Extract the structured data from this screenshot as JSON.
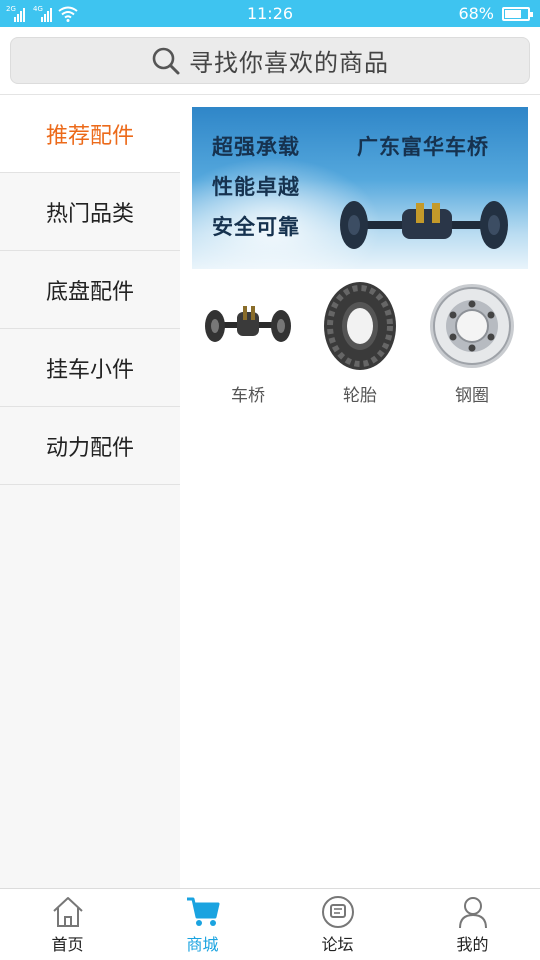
{
  "status_bar": {
    "sim1_network": "2G",
    "sim2_network": "4G",
    "time": "11:26",
    "battery_percent": "68%",
    "battery_level": 0.68
  },
  "search": {
    "placeholder": "寻找你喜欢的商品"
  },
  "sidebar": {
    "items": [
      {
        "label": "推荐配件",
        "active": true
      },
      {
        "label": "热门品类",
        "active": false
      },
      {
        "label": "底盘配件",
        "active": false
      },
      {
        "label": "挂车小件",
        "active": false
      },
      {
        "label": "动力配件",
        "active": false
      }
    ]
  },
  "banner": {
    "line1": "超强承载",
    "line2": "性能卓越",
    "line3": "安全可靠",
    "brand": "广东富华车桥"
  },
  "categories": [
    {
      "label": "车桥",
      "icon": "axle-icon"
    },
    {
      "label": "轮胎",
      "icon": "tire-icon"
    },
    {
      "label": "钢圈",
      "icon": "wheel-rim-icon"
    }
  ],
  "bottom_nav": {
    "items": [
      {
        "label": "首页",
        "icon": "home-icon",
        "active": false
      },
      {
        "label": "商城",
        "icon": "cart-icon",
        "active": true
      },
      {
        "label": "论坛",
        "icon": "forum-icon",
        "active": false
      },
      {
        "label": "我的",
        "icon": "user-icon",
        "active": false
      }
    ]
  },
  "colors": {
    "status_bar": "#3ec4f0",
    "active_sidebar_text": "#ec6a1a",
    "active_nav": "#1aa3e0"
  }
}
